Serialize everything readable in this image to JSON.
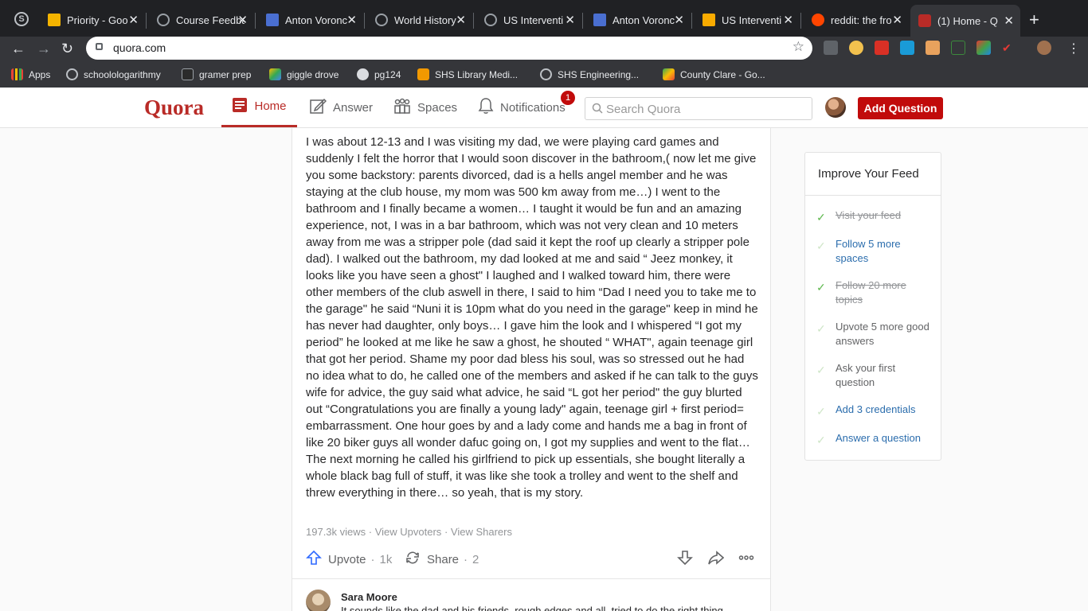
{
  "browser": {
    "tabs": [
      {
        "title": "Priority - Goo",
        "color": "#f4b400"
      },
      {
        "title": "Course Feedba",
        "color": "#5f6368"
      },
      {
        "title": "Anton Voronc",
        "color": "#4a6fd1"
      },
      {
        "title": "World History",
        "color": "#5f6368"
      },
      {
        "title": "US Interventi",
        "color": "#5f6368"
      },
      {
        "title": "Anton Voronc",
        "color": "#4a6fd1"
      },
      {
        "title": "US Interventi",
        "color": "#f9ab00"
      },
      {
        "title": "reddit: the fro",
        "color": "#ff4500"
      },
      {
        "title": "(1) Home - Q",
        "color": "#b92b27"
      }
    ],
    "url": "quora.com",
    "bookmarks": [
      {
        "label": "Apps"
      },
      {
        "label": "schoolologarithmy"
      },
      {
        "label": "gramer prep"
      },
      {
        "label": "giggle drove"
      },
      {
        "label": "pg124"
      },
      {
        "label": "SHS Library Medi..."
      },
      {
        "label": "SHS Engineering..."
      },
      {
        "label": "County Clare - Go..."
      }
    ]
  },
  "quora": {
    "logo": "Quora",
    "nav": {
      "home": "Home",
      "answer": "Answer",
      "spaces": "Spaces",
      "notifications": "Notifications",
      "notification_count": "1"
    },
    "search_placeholder": "Search Quora",
    "add_question": "Add Question"
  },
  "answer": {
    "text": "I was about 12-13 and I was visiting my dad, we were playing card games and suddenly I felt the horror that I would soon discover in the bathroom,( now let me give you some backstory: parents divorced, dad is a hells angel member and he was staying at the club house, my mom was 500 km away from me…) I went to the bathroom and I finally became a women… I taught it would be fun and an amazing experience, not, I was in a bar bathroom, which was not very clean and 10 meters away from me was a stripper pole (dad said it kept the roof up clearly a stripper pole dad). I walked out the bathroom, my dad looked at me and said “ Jeez monkey, it looks like you have seen a ghost\" I laughed and I walked toward him, there were other members of the club aswell in there, I said to him “Dad I need you to take me to the garage\" he said “Nuni it is 10pm what do you need in the garage\" keep in mind he has never had daughter, only boys… I gave him the look and I whispered “I got my period” he looked at me like he saw a ghost, he shouted “ WHAT\", again teenage girl that got her period. Shame my poor dad bless his soul, was so stressed out he had no idea what to do, he called one of the members and asked if he can talk to the guys wife for advice, the guy said what advice, he said “L got her period\" the guy blurted out “Congratulations you are finally a young lady\" again, teenage girl + first period= embarrassment. One hour goes by and a lady come and hands me a bag in front of like 20 biker guys all wonder dafuc going on, I got my supplies and went to the flat… The next morning he called his girlfriend to pick up essentials, she bought literally a whole black bag full of stuff, it was like she took a trolley and went to the shelf and threw everything in there… so yeah, that is my story.",
    "views": "197.3k views",
    "view_upvoters": "View Upvoters",
    "view_sharers": "View Sharers",
    "upvote_label": "Upvote",
    "upvote_count": "1k",
    "share_label": "Share",
    "share_count": "2"
  },
  "comment": {
    "author": "Sara Moore",
    "preview": "It sounds like the dad and his friends, rough edges and all, tried to do the right thing"
  },
  "improve_feed": {
    "title": "Improve Your Feed",
    "items": [
      {
        "label": "Visit your feed",
        "state": "done"
      },
      {
        "label": "Follow 5 more spaces",
        "state": "link"
      },
      {
        "label": "Follow 20 more topics",
        "state": "done"
      },
      {
        "label": "Upvote 5 more good answers",
        "state": "todo"
      },
      {
        "label": "Ask your first question",
        "state": "todo"
      },
      {
        "label": "Add 3 credentials",
        "state": "link"
      },
      {
        "label": "Answer a question",
        "state": "link"
      }
    ]
  }
}
